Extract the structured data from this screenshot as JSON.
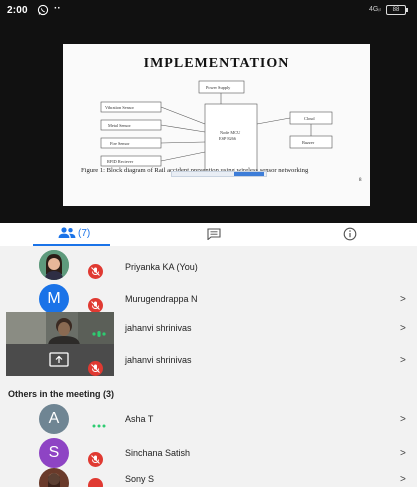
{
  "status_bar": {
    "time": "2:00",
    "dots": "··",
    "signal": "4Gᵢₗ",
    "battery": "88"
  },
  "slide": {
    "title": "IMPLEMENTATION",
    "blocks": {
      "power_supply": "Power Supply",
      "vibration_sensor": "Vibration Sensor",
      "metal_sensor": "Metal Sensor",
      "fire_sensor": "Fire Sensor",
      "rfid_reciever": "RFID Reciever",
      "controller_line1": "Node MCU",
      "controller_line2": "ESP 8266",
      "cloud": "Cloud",
      "buzzer": "Buzzer"
    },
    "caption": "Figure 1: Block diagram of Rail accident prevention using wireless sensor networking",
    "page_mark": "8"
  },
  "tabs": {
    "people_count": "(7)",
    "active": "people",
    "accent": "#1a73e8"
  },
  "participants": [
    {
      "name": "Priyanka KA (You)",
      "avatar": "photo",
      "muted": true,
      "chevron": ""
    },
    {
      "name": "Murugendrappa N",
      "avatar": "M",
      "avatar_color": "#1a73e8",
      "muted": true,
      "chevron": ">"
    },
    {
      "name": "jahanvi shrinivas",
      "avatar": "video",
      "muted": false,
      "speaking": true,
      "chevron": ">"
    },
    {
      "name": "jahanvi shrinivas",
      "avatar": "screen-share",
      "muted": true,
      "chevron": ">"
    }
  ],
  "others_header": "Others in the meeting (3)",
  "others": [
    {
      "name": "Asha T",
      "avatar": "A",
      "avatar_color": "#6f8593",
      "speaking": true,
      "chevron": ">"
    },
    {
      "name": "Sinchana Satish",
      "avatar": "S",
      "avatar_color": "#8e44c4",
      "muted": true,
      "chevron": ">"
    },
    {
      "name": "Sony S",
      "avatar": "photo",
      "muted": true,
      "chevron": ">"
    }
  ],
  "colors": {
    "mute_red": "#e03a32",
    "speaking_green": "#2ecc71",
    "list_background": "#f2f2f2"
  }
}
